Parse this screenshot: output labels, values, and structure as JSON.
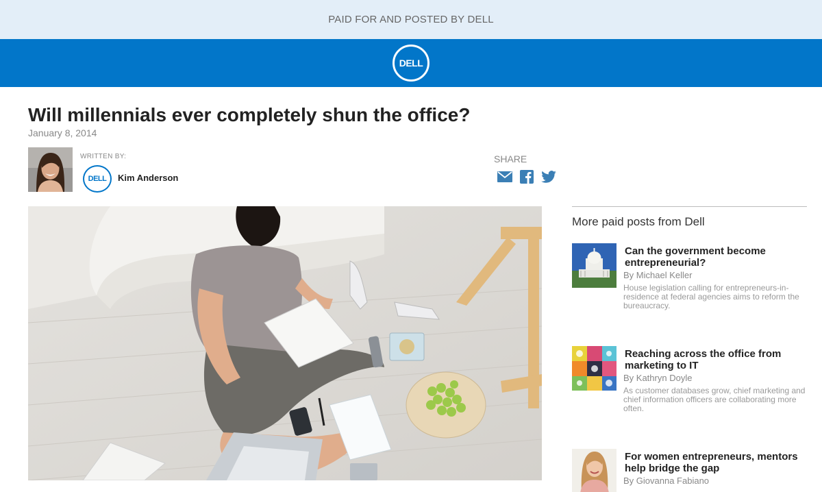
{
  "top_bar": {
    "text": "PAID FOR AND POSTED BY DELL"
  },
  "brand": {
    "logo_text": "DELL",
    "color": "#0276c9"
  },
  "article": {
    "title": "Will millennials ever completely shun the office?",
    "date": "January 8, 2014",
    "written_by_label": "WRITTEN BY:",
    "author_logo_text": "DELL",
    "author_name": "Kim Anderson",
    "share_label": "SHARE",
    "share_icons": [
      "email-icon",
      "facebook-icon",
      "twitter-icon"
    ]
  },
  "sidebar": {
    "heading": "More paid posts from Dell",
    "posts": [
      {
        "title": "Can the government become entrepreneurial?",
        "author": "By Michael Keller",
        "description": "House legislation calling for entrepreneurs-in-residence at federal agencies aims to reform the bureaucracy."
      },
      {
        "title": "Reaching across the office from marketing to IT",
        "author": "By Kathryn Doyle",
        "description": "As customer databases grow, chief marketing and chief information officers are collaborating more often."
      },
      {
        "title": "For women entrepreneurs, mentors help bridge the gap",
        "author": "By Giovanna Fabiano",
        "description": ""
      }
    ]
  }
}
